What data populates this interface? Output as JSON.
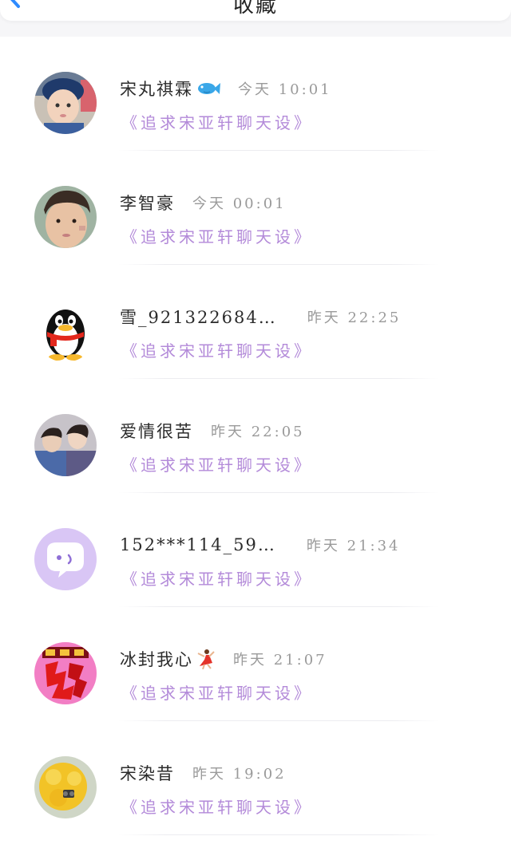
{
  "header": {
    "title": "收藏",
    "back_icon": "chevron-left-icon"
  },
  "colors": {
    "accent": "#2e8bff",
    "subtitle": "#b38ad9",
    "time": "#9a9a9a"
  },
  "items": [
    {
      "name": "宋丸祺霖",
      "emoji": "fish-emoji",
      "time": "今天 10:01",
      "subtitle": "《追求宋亚轩聊天设》",
      "avatar": "child-avatar"
    },
    {
      "name": "李智豪",
      "emoji": "",
      "time": "今天 00:01",
      "subtitle": "《追求宋亚轩聊天设》",
      "avatar": "boy-avatar"
    },
    {
      "name": "雪_921322684…",
      "emoji": "",
      "time": "昨天 22:25",
      "subtitle": "《追求宋亚轩聊天设》",
      "avatar": "qq-penguin-avatar"
    },
    {
      "name": "爱情很苦",
      "emoji": "",
      "time": "昨天 22:05",
      "subtitle": "《追求宋亚轩聊天设》",
      "avatar": "couple-avatar"
    },
    {
      "name": "152***114_59…",
      "emoji": "",
      "time": "昨天 21:34",
      "subtitle": "《追求宋亚轩聊天设》",
      "avatar": "chat-bubble-avatar"
    },
    {
      "name": "冰封我心",
      "emoji": "dancer-emoji",
      "time": "昨天 21:07",
      "subtitle": "《追求宋亚轩聊天设》",
      "avatar": "yuan-character-avatar"
    },
    {
      "name": "宋染昔",
      "emoji": "",
      "time": "昨天 19:02",
      "subtitle": "《追求宋亚轩聊天设》",
      "avatar": "yellow-flower-avatar"
    }
  ]
}
